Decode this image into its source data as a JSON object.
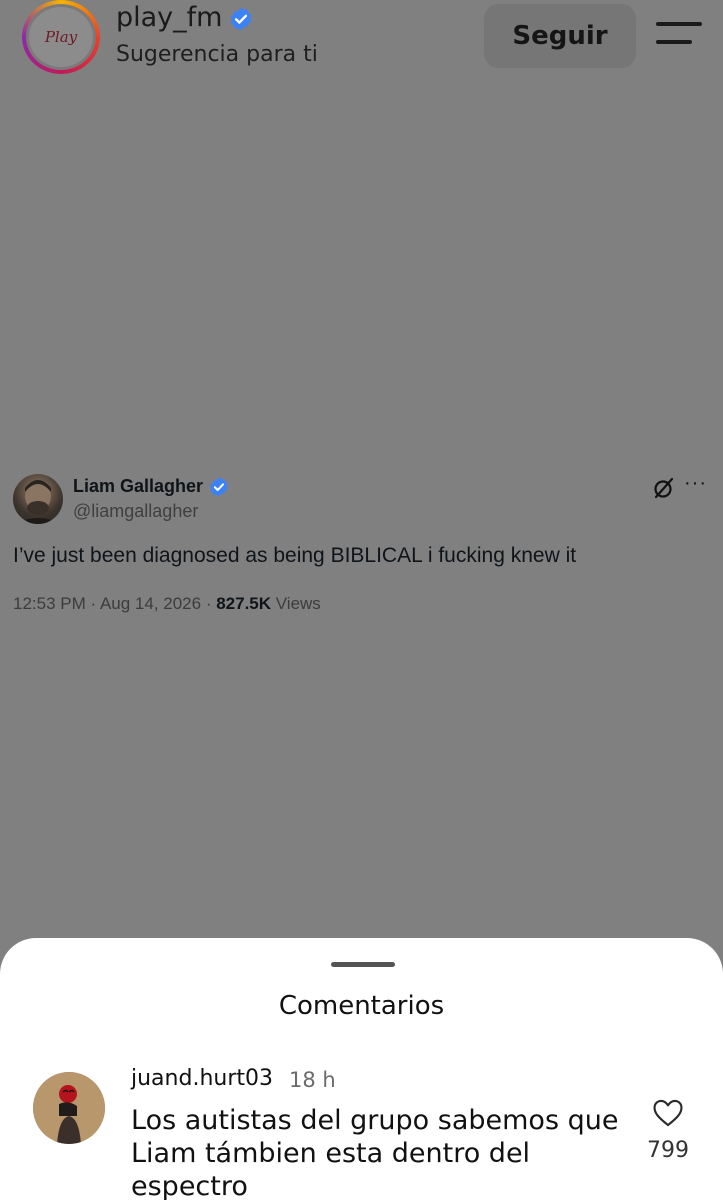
{
  "header": {
    "account_name": "play_fm",
    "subtitle": "Sugerencia para ti",
    "avatar_logo": "Play",
    "follow_label": "Seguir",
    "verified_icon": "verified-badge-icon",
    "menu_icon": "hamburger-menu-icon"
  },
  "tweet": {
    "author": "Liam Gallagher",
    "handle": "@liamgallagher",
    "text": "I’ve just been diagnosed as being BIBLICAL i fucking knew it",
    "time": "12:53 PM",
    "date": "Aug 14, 2026",
    "views_count": "827.5K",
    "views_label": "Views",
    "more_label": "···",
    "separator": " · "
  },
  "comments_sheet": {
    "title": "Comentarios",
    "comments": [
      {
        "user": "juand.hurt03",
        "time": "18 h",
        "text": "Los autistas del grupo sabemos que Liam támbien esta dentro del espectro",
        "likes": "799"
      }
    ]
  },
  "colors": {
    "overlay_bg": "#808080",
    "verified_blue": "#3b82f6",
    "sheet_bg": "#ffffff"
  }
}
